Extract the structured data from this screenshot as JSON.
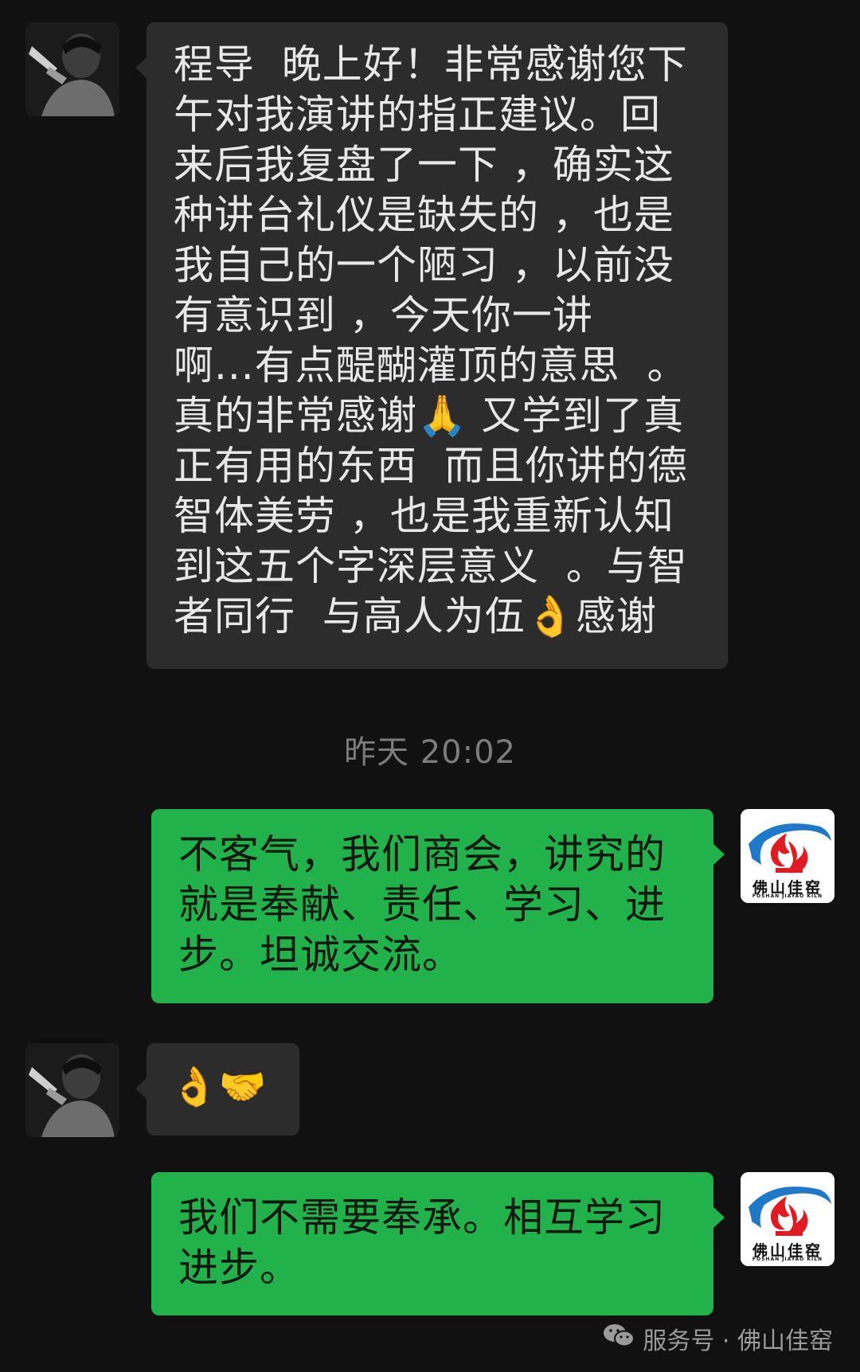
{
  "chat": {
    "messages": [
      {
        "sender": "contact",
        "text": "程导  晚上好！非常感谢您下午对我演讲的指正建议。回来后我复盘了一下 ，确实这种讲台礼仪是缺失的 ，也是我自己的一个陋习 ，以前没有意识到 ，今天你一讲  啊...有点醍醐灌顶的意思  。真的非常感谢🙏 又学到了真正有用的东西  而且你讲的德智体美劳 ，也是我重新认知到这五个字深层意义  。与智者同行  与高人为伍👌感谢"
      },
      {
        "sender": "me",
        "text": "不客气，我们商会，讲究的就是奉献、责任、学习、进步。坦诚交流。"
      },
      {
        "sender": "contact",
        "text": "👌🤝"
      },
      {
        "sender": "me",
        "text": "我们不需要奉承。相互学习进步。"
      }
    ],
    "timestamp": "昨天 20:02"
  },
  "brand_avatar": {
    "text": "佛山佳窑",
    "subtext": "FOSHAN JIAYAO KILN"
  },
  "watermark": {
    "text": "服务号 · 佛山佳窑",
    "icon": "wechat-icon"
  },
  "colors": {
    "background": "#111111",
    "incoming_bubble": "#2c2c2c",
    "outgoing_bubble": "#22b24c",
    "timestamp": "#7c7c7c"
  }
}
